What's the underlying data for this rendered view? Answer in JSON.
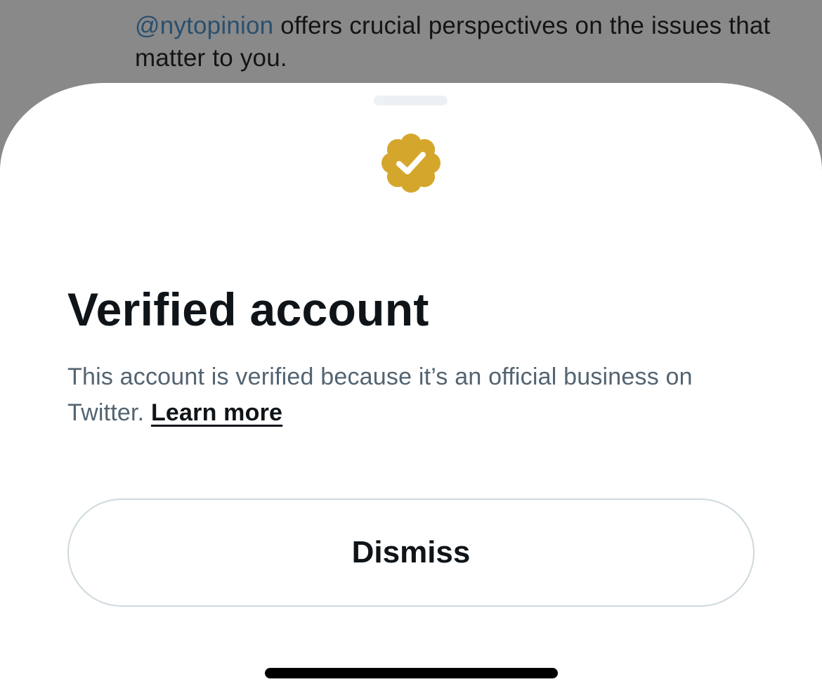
{
  "background_tweet": {
    "mention": "@nytopinion",
    "text": " offers crucial perspectives on the issues that matter to you."
  },
  "sheet": {
    "badge_icon": "verified-checkmark-badge-icon",
    "badge_color": "#D4A72C",
    "title": "Verified account",
    "description": "This account is verified because it’s an official business on Twitter.",
    "learn_more_label": "Learn more",
    "dismiss_label": "Dismiss"
  }
}
